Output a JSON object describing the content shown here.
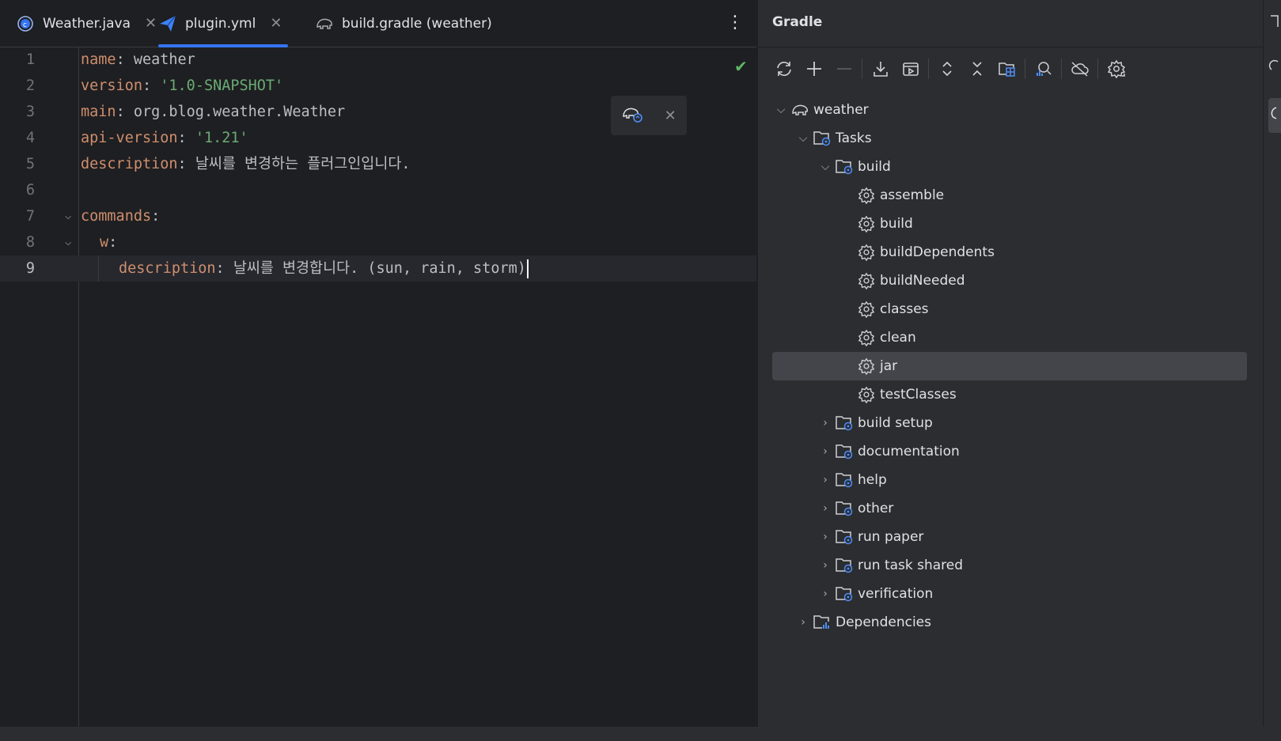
{
  "tabs": [
    {
      "label": "Weather.java",
      "icon": "java-class-icon",
      "closable": true,
      "active": false
    },
    {
      "label": "plugin.yml",
      "icon": "paper-plane-icon",
      "closable": true,
      "active": true
    },
    {
      "label": "build.gradle (weather)",
      "icon": "gradle-elephant-icon",
      "closable": false,
      "active": false
    }
  ],
  "editor": {
    "lines": [
      {
        "num": "1",
        "key": "name",
        "sep": ": ",
        "value": "weather",
        "value_type": "plain"
      },
      {
        "num": "2",
        "key": "version",
        "sep": ": ",
        "value": "'1.0-SNAPSHOT'",
        "value_type": "string"
      },
      {
        "num": "3",
        "key": "main",
        "sep": ": ",
        "value": "org.blog.weather.Weather",
        "value_type": "plain"
      },
      {
        "num": "4",
        "key": "api-version",
        "sep": ": ",
        "value": "'1.21'",
        "value_type": "string"
      },
      {
        "num": "5",
        "key": "description",
        "sep": ": ",
        "value": "날씨를 변경하는 플러그인입니다.",
        "value_type": "plain"
      },
      {
        "num": "6",
        "key": "",
        "sep": "",
        "value": "",
        "value_type": "plain"
      },
      {
        "num": "7",
        "key": "commands",
        "sep": ":",
        "value": "",
        "value_type": "plain"
      },
      {
        "num": "8",
        "key": "w",
        "sep": ":",
        "value": "",
        "value_type": "plain"
      },
      {
        "num": "9",
        "key": "description",
        "sep": ": ",
        "value": "날씨를 변경합니다. (sun, rain, storm)",
        "value_type": "plain"
      }
    ],
    "status": "no-problems"
  },
  "gradle": {
    "title": "Gradle",
    "toolbar": [
      "reload-icon",
      "add-icon",
      "remove-icon",
      "download-icon",
      "run-config-icon",
      "expand-all-icon",
      "collapse-all-icon",
      "group-modules-icon",
      "analyze-icon",
      "offline-mode-icon",
      "settings-icon"
    ],
    "tree": [
      {
        "label": "weather",
        "icon": "gradle-elephant-icon",
        "chevron": "down"
      },
      {
        "label": "Tasks",
        "icon": "task-folder-icon",
        "chevron": "down"
      },
      {
        "label": "build",
        "icon": "task-folder-icon",
        "chevron": "down"
      },
      {
        "label": "assemble",
        "icon": "gear-icon",
        "chevron": ""
      },
      {
        "label": "build",
        "icon": "gear-icon",
        "chevron": ""
      },
      {
        "label": "buildDependents",
        "icon": "gear-icon",
        "chevron": ""
      },
      {
        "label": "buildNeeded",
        "icon": "gear-icon",
        "chevron": ""
      },
      {
        "label": "classes",
        "icon": "gear-icon",
        "chevron": ""
      },
      {
        "label": "clean",
        "icon": "gear-icon",
        "chevron": ""
      },
      {
        "label": "jar",
        "icon": "gear-icon",
        "chevron": "",
        "selected": true
      },
      {
        "label": "testClasses",
        "icon": "gear-icon",
        "chevron": ""
      },
      {
        "label": "build setup",
        "icon": "task-folder-icon",
        "chevron": "right"
      },
      {
        "label": "documentation",
        "icon": "task-folder-icon",
        "chevron": "right"
      },
      {
        "label": "help",
        "icon": "task-folder-icon",
        "chevron": "right"
      },
      {
        "label": "other",
        "icon": "task-folder-icon",
        "chevron": "right"
      },
      {
        "label": "run paper",
        "icon": "task-folder-icon",
        "chevron": "right"
      },
      {
        "label": "run task shared",
        "icon": "task-folder-icon",
        "chevron": "right"
      },
      {
        "label": "verification",
        "icon": "task-folder-icon",
        "chevron": "right"
      },
      {
        "label": "Dependencies",
        "icon": "dependencies-folder-icon",
        "chevron": "right"
      }
    ]
  },
  "colors": {
    "accent": "#3574f0",
    "keyword": "#cf8e6d",
    "string": "#6aab73",
    "success": "#5fb865"
  }
}
